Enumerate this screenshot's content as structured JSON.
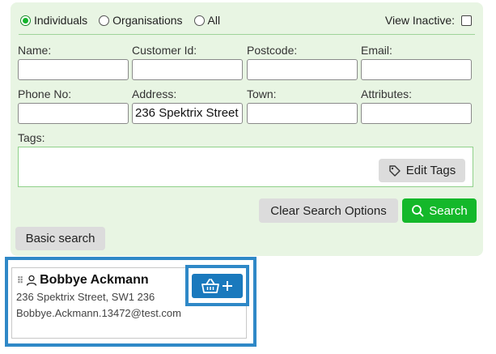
{
  "filter": {
    "options": [
      {
        "label": "Individuals",
        "selected": true
      },
      {
        "label": "Organisations",
        "selected": false
      },
      {
        "label": "All",
        "selected": false
      }
    ],
    "view_inactive_label": "View Inactive:",
    "view_inactive_checked": false
  },
  "fields": {
    "name": {
      "label": "Name:",
      "value": ""
    },
    "customer_id": {
      "label": "Customer Id:",
      "value": ""
    },
    "postcode": {
      "label": "Postcode:",
      "value": ""
    },
    "email": {
      "label": "Email:",
      "value": ""
    },
    "phone": {
      "label": "Phone No:",
      "value": ""
    },
    "address": {
      "label": "Address:",
      "value": "236 Spektrix Street"
    },
    "town": {
      "label": "Town:",
      "value": ""
    },
    "attributes": {
      "label": "Attributes:",
      "value": ""
    }
  },
  "tags": {
    "label": "Tags:",
    "edit_label": "Edit Tags"
  },
  "actions": {
    "clear_label": "Clear Search Options",
    "search_label": "Search",
    "basic_label": "Basic search"
  },
  "result": {
    "name": "Bobbye Ackmann",
    "address": "236 Spektrix Street, SW1 236",
    "email": "Bobbye.Ackmann.13472@test.com",
    "add_icon": "basket-plus-icon"
  },
  "colors": {
    "accent_green": "#14b82a",
    "panel_bg": "#e8f5e3",
    "highlight_blue": "#2f88c7",
    "basket_blue": "#1a79bd"
  }
}
